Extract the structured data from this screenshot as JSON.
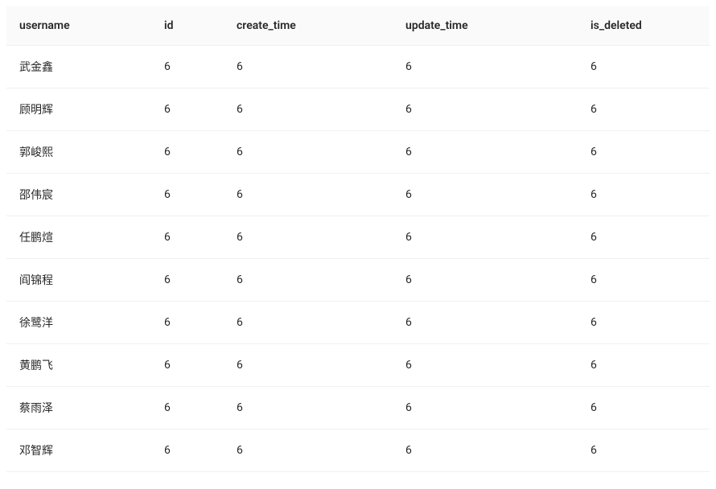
{
  "table": {
    "headers": {
      "username": "username",
      "id": "id",
      "create_time": "create_time",
      "update_time": "update_time",
      "is_deleted": "is_deleted"
    },
    "rows": [
      {
        "username": "武金鑫",
        "id": "6",
        "create_time": "6",
        "update_time": "6",
        "is_deleted": "6"
      },
      {
        "username": "顾明辉",
        "id": "6",
        "create_time": "6",
        "update_time": "6",
        "is_deleted": "6"
      },
      {
        "username": "郭峻熙",
        "id": "6",
        "create_time": "6",
        "update_time": "6",
        "is_deleted": "6"
      },
      {
        "username": "邵伟宸",
        "id": "6",
        "create_time": "6",
        "update_time": "6",
        "is_deleted": "6"
      },
      {
        "username": "任鹏煊",
        "id": "6",
        "create_time": "6",
        "update_time": "6",
        "is_deleted": "6"
      },
      {
        "username": "阎锦程",
        "id": "6",
        "create_time": "6",
        "update_time": "6",
        "is_deleted": "6"
      },
      {
        "username": "徐鹭洋",
        "id": "6",
        "create_time": "6",
        "update_time": "6",
        "is_deleted": "6"
      },
      {
        "username": "黄鹏飞",
        "id": "6",
        "create_time": "6",
        "update_time": "6",
        "is_deleted": "6"
      },
      {
        "username": "蔡雨泽",
        "id": "6",
        "create_time": "6",
        "update_time": "6",
        "is_deleted": "6"
      },
      {
        "username": "邓智辉",
        "id": "6",
        "create_time": "6",
        "update_time": "6",
        "is_deleted": "6"
      }
    ]
  }
}
